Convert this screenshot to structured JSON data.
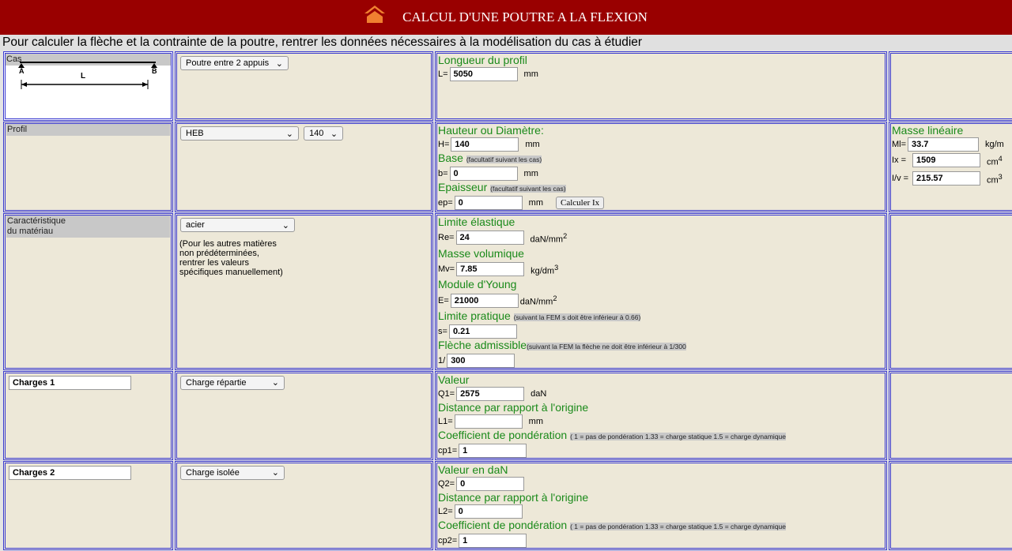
{
  "header": {
    "title": "CALCUL D'UNE POUTRE A LA FLEXION",
    "home_icon": "home-icon",
    "color": "#990000"
  },
  "intro": "Pour calculer la flèche et la contrainte de la poutre, rentrer les données nécessaires à la modélisation du cas à étudier",
  "cas": {
    "label": "Cas",
    "diagram": {
      "a": "A",
      "b": "B",
      "l": "L"
    },
    "select": "Poutre entre 2 appuis",
    "title": "Longueur du profil",
    "L_label": "L=",
    "L_value": "5050",
    "unit": "mm"
  },
  "profil": {
    "label": "Profil",
    "type": "HEB",
    "size": "140",
    "hauteur": {
      "title": "Hauteur ou Diamètre:",
      "label": "H=",
      "value": "140",
      "unit": "mm"
    },
    "base": {
      "title": "Base",
      "note": "(facultatif suivant les cas)",
      "label": "b=",
      "value": "0",
      "unit": "mm"
    },
    "epaisseur": {
      "title": "Epaisseur",
      "note": "(facultatif suivant les cas)",
      "label": "ep=",
      "value": "0",
      "unit": "mm",
      "button": "Calculer Ix"
    },
    "masse": {
      "title": "Masse linéaire",
      "ml_label": "Ml=",
      "ml_value": "33.7",
      "ml_unit": "kg/m",
      "ix_label": "Ix =",
      "ix_value": "1509",
      "ix_unit": "cm",
      "ix_exp": "4",
      "iv_label": "I/v =",
      "iv_value": "215.57",
      "iv_unit": "cm",
      "iv_exp": "3"
    }
  },
  "materiau": {
    "label1": "Caractéristique",
    "label2": "du matériau",
    "select": "acier",
    "help": [
      "(Pour les autres matières",
      "non prédéterminées,",
      "rentrer les valeurs",
      "spécifiques manuellement)"
    ],
    "re": {
      "title": "Limite élastique",
      "label": "Re=",
      "value": "24",
      "unit": "daN/mm",
      "exp": "2"
    },
    "mv": {
      "title": "Masse volumique",
      "label": "Mv=",
      "value": "7.85",
      "unit": "kg/dm",
      "exp": "3"
    },
    "e": {
      "title": "Module d'Young",
      "label": "E=",
      "value": "21000",
      "unit": "daN/mm",
      "exp": "2"
    },
    "s": {
      "title": "Limite pratique",
      "note": "(suivant la FEM s doit être inférieur à 0.66)",
      "label": "s=",
      "value": "0.21"
    },
    "fleche": {
      "title": "Flèche admissible",
      "note": "(suivant la FEM la flèche ne doit être inférieur à 1/300",
      "label": "1/",
      "value": "300"
    }
  },
  "charges1": {
    "name": "Charges 1",
    "select": "Charge répartie",
    "valeur_title": "Valeur",
    "q_label": "Q1=",
    "q_value": "2575",
    "q_unit": "daN",
    "dist_title": "Distance par rapport à l'origine",
    "l_label": "L1=",
    "l_value": "",
    "l_unit": "mm",
    "coef_title": "Coefficient de pondération",
    "coef_note": "( 1 = pas de pondération 1.33 = charge statique 1.5 = charge dynamique",
    "cp_label": "cp1=",
    "cp_value": "1"
  },
  "charges2": {
    "name": "Charges 2",
    "select": "Charge isolée",
    "valeur_title": "Valeur en daN",
    "q_label": "Q2=",
    "q_value": "0",
    "dist_title": "Distance par rapport à l'origine",
    "l_label": "L2=",
    "l_value": "0",
    "coef_title": "Coefficient de pondération",
    "coef_note": "( 1 = pas de pondération 1.33 = charge statique 1.5 = charge dynamique",
    "cp_label": "cp2=",
    "cp_value": "1"
  }
}
